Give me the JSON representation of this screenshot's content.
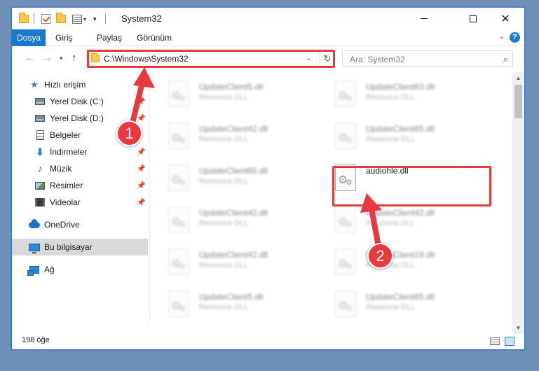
{
  "window": {
    "title": "System32",
    "controls": {
      "minimize": "",
      "maximize": "",
      "close": "✕"
    }
  },
  "ribbon": {
    "tabs": [
      "Dosya",
      "Giriş",
      "Paylaş",
      "Görünüm"
    ],
    "help": "?"
  },
  "nav": {
    "address": "C:\\Windows\\System32",
    "search_placeholder": "Ara: System32"
  },
  "sidebar": {
    "items": [
      {
        "label": "Hızlı erişim",
        "icon": "star-icon"
      },
      {
        "label": "Yerel Disk (C:)",
        "icon": "drive-icon"
      },
      {
        "label": "Yerel Disk (D:)",
        "icon": "drive-icon"
      },
      {
        "label": "Belgeler",
        "icon": "documents-icon"
      },
      {
        "label": "İndirmeler",
        "icon": "download-icon"
      },
      {
        "label": "Müzik",
        "icon": "music-icon"
      },
      {
        "label": "Resimler",
        "icon": "pictures-icon"
      },
      {
        "label": "Videolar",
        "icon": "videos-icon"
      },
      {
        "label": "OneDrive",
        "icon": "onedrive-icon"
      },
      {
        "label": "Bu bilgisayar",
        "icon": "this-pc-icon"
      },
      {
        "label": "Ağ",
        "icon": "network-icon"
      }
    ]
  },
  "files": {
    "left": [
      {
        "name": "UpdateClient5.dll",
        "type": "Resource DLL"
      },
      {
        "name": "UpdateClient42.dll",
        "type": "Resource DLL"
      },
      {
        "name": "UpdateClient65.dll",
        "type": "Resource DLL"
      },
      {
        "name": "UpdateClient42.dll",
        "type": "Resource DLL"
      },
      {
        "name": "UpdateClient42.dll",
        "type": "Resource DLL"
      },
      {
        "name": "UpdateClient5.dll",
        "type": "Resource DLL"
      }
    ],
    "right": [
      {
        "name": "UpdateClient63.dll",
        "type": "Resource DLL"
      },
      {
        "name": "UpdateClient65.dll",
        "type": "Resource DLL"
      },
      {
        "name": "audiohle.dll",
        "type": ""
      },
      {
        "name": "UpdateClient42.dll",
        "type": "Resource DLL"
      },
      {
        "name": "UpdateClient19.dll",
        "type": "Resource DLL"
      },
      {
        "name": "UpdateClient65.dll",
        "type": "Resource DLL"
      }
    ]
  },
  "status": {
    "count": "198 öğe"
  },
  "annotations": {
    "marker1": "1",
    "marker2": "2"
  },
  "colors": {
    "accent": "#1979ca",
    "annotation": "#e8393e"
  }
}
